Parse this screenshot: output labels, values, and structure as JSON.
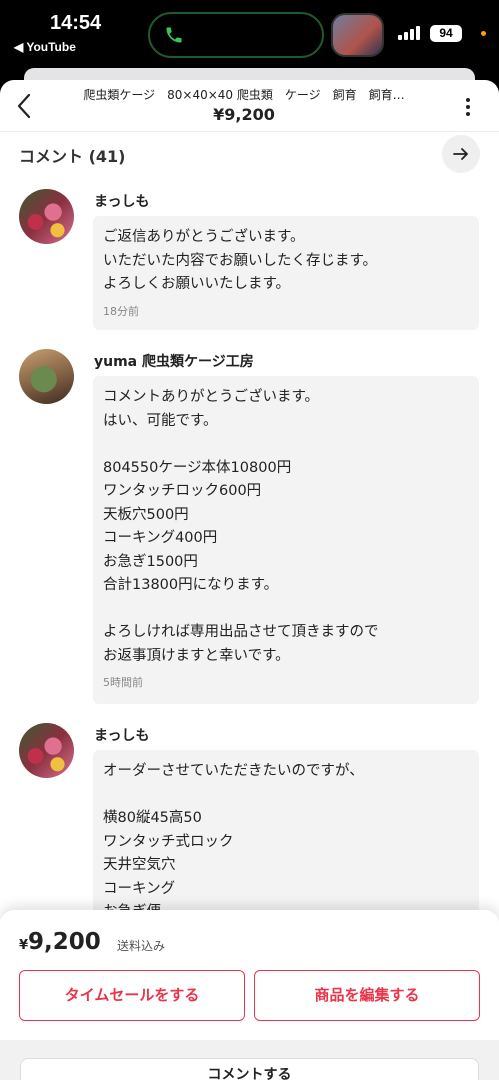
{
  "status_bar": {
    "time": "14:54",
    "back_app": "◀ YouTube",
    "battery": "94"
  },
  "header": {
    "title": "爬虫類ケージ　80×40×40 爬虫類　ケージ　飼育　飼育…",
    "price": "¥9,200"
  },
  "comments_section": {
    "title": "コメント (41)"
  },
  "comments": [
    {
      "author": "まっしも",
      "text": "ご返信ありがとうございます。\nいただいた内容でお願いしたく存じます。\nよろしくお願いいたします。",
      "ago": "18分前"
    },
    {
      "author": "yuma 爬虫類ケージ工房",
      "text": "コメントありがとうございます。\nはい、可能です。\n\n804550ケージ本体10800円\nワンタッチロック600円\n天板穴500円\nコーキング400円\nお急ぎ1500円\n合計13800円になります。\n\nよろしければ専用出品させて頂きますので\nお返事頂けますと幸いです。",
      "ago": "5時間前"
    },
    {
      "author": "まっしも",
      "text": "オーダーさせていただきたいのですが、\n\n横80縦45高50\nワンタッチ式ロック\n天井空気穴\nコーキング\nお急ぎ便",
      "ago": ""
    }
  ],
  "bottom_bar": {
    "price_symbol": "¥",
    "price": "9,200",
    "shipping": "送料込み",
    "timesale_button": "タイムセールをする",
    "edit_button": "商品を編集する",
    "comment_button": "コメントする"
  },
  "colors": {
    "accent": "#e8354a",
    "bubble": "#f3f3f3"
  }
}
